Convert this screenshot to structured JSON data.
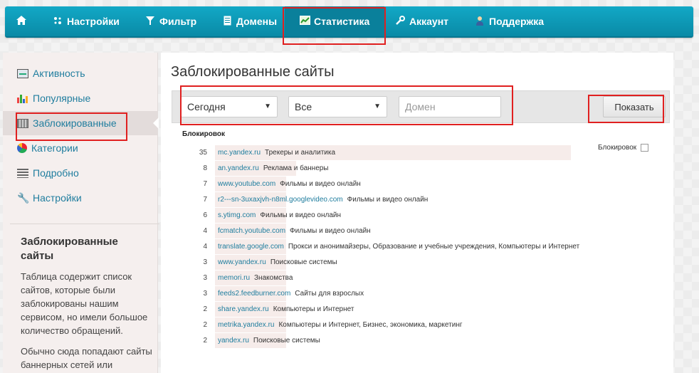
{
  "nav": {
    "items": [
      {
        "label": "Настройки",
        "icon": "settings-icon"
      },
      {
        "label": "Фильтр",
        "icon": "filter-icon"
      },
      {
        "label": "Домены",
        "icon": "domains-icon"
      },
      {
        "label": "Статистика",
        "icon": "stats-icon"
      },
      {
        "label": "Аккаунт",
        "icon": "wrench-icon"
      },
      {
        "label": "Поддержка",
        "icon": "user-icon"
      }
    ],
    "active": "Статистика"
  },
  "sidebar": {
    "items": [
      {
        "label": "Активность",
        "icon": "activity-icon"
      },
      {
        "label": "Популярные",
        "icon": "bar-chart-icon"
      },
      {
        "label": "Заблокированные",
        "icon": "blocked-icon"
      },
      {
        "label": "Категории",
        "icon": "pie-chart-icon"
      },
      {
        "label": "Подробно",
        "icon": "list-icon"
      },
      {
        "label": "Настройки",
        "icon": "wrench-icon"
      }
    ],
    "active": "Заблокированные",
    "info_title": "Заблокированные сайты",
    "info_text_1": "Таблица содержит список сайтов, которые были заблокированы нашим сервисом, но имели большое количество обращений.",
    "info_text_2": "Обычно сюда попадают сайты баннерных сетей или"
  },
  "main": {
    "title": "Заблокированные сайты",
    "filters": {
      "period": "Сегодня",
      "scope": "Все",
      "domain_placeholder": "Домен",
      "show_button": "Показать"
    },
    "column_header": "Блокировок",
    "legend_label": "Блокировок",
    "rows": [
      {
        "count": "35",
        "domain": "mc.yandex.ru",
        "categories": "Трекеры и аналитика"
      },
      {
        "count": "8",
        "domain": "an.yandex.ru",
        "categories": "Реклама и баннеры"
      },
      {
        "count": "7",
        "domain": "www.youtube.com",
        "categories": "Фильмы и видео онлайн"
      },
      {
        "count": "7",
        "domain": "r2---sn-3uxaxjvh-n8ml.googlevideo.com",
        "categories": "Фильмы и видео онлайн"
      },
      {
        "count": "6",
        "domain": "s.ytimg.com",
        "categories": "Фильмы и видео онлайн"
      },
      {
        "count": "4",
        "domain": "fcmatch.youtube.com",
        "categories": "Фильмы и видео онлайн"
      },
      {
        "count": "4",
        "domain": "translate.google.com",
        "categories": "Прокси и анонимайзеры, Образование и учебные учреждения, Компьютеры и Интернет"
      },
      {
        "count": "3",
        "domain": "www.yandex.ru",
        "categories": "Поисковые системы"
      },
      {
        "count": "3",
        "domain": "memori.ru",
        "categories": "Знакомства"
      },
      {
        "count": "3",
        "domain": "feeds2.feedburner.com",
        "categories": "Сайты для взрослых"
      },
      {
        "count": "2",
        "domain": "share.yandex.ru",
        "categories": "Компьютеры и Интернет"
      },
      {
        "count": "2",
        "domain": "metrika.yandex.ru",
        "categories": "Компьютеры и Интернет, Бизнес, экономика, маркетинг"
      },
      {
        "count": "2",
        "domain": "yandex.ru",
        "categories": "Поисковые системы"
      }
    ]
  },
  "colors": {
    "nav_bg": "#0a9bba",
    "link": "#1f7d9e",
    "highlight_border": "#e02020"
  }
}
